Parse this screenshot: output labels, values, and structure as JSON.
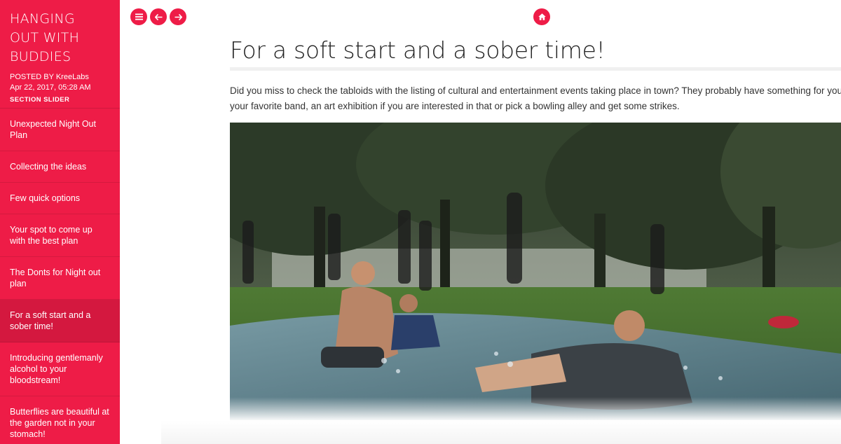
{
  "sidebar": {
    "title": "HANGING OUT WITH BUDDIES",
    "posted_by_label": "POSTED BY",
    "author": "KreeLabs",
    "date": "Apr 22, 2017, 05:28 AM",
    "section": "SECTION SLIDER",
    "items": [
      {
        "label": "Unexpected Night Out Plan"
      },
      {
        "label": "Collecting the ideas"
      },
      {
        "label": "Few quick options"
      },
      {
        "label": "Your spot to come up with the best plan"
      },
      {
        "label": "The Donts for Night out plan"
      },
      {
        "label": "For a soft start and a sober time!"
      },
      {
        "label": "Introducing gentlemanly alcohol to your bloodstream!"
      },
      {
        "label": "Butterflies are beautiful at the garden not in your stomach!"
      }
    ],
    "active_index": 5
  },
  "toolbar": {
    "menu_icon": "menu-icon",
    "prev_icon": "arrow-left-icon",
    "next_icon": "arrow-right-icon",
    "home_icon": "home-icon"
  },
  "article": {
    "title": "For a soft start and a sober time!",
    "intro_line1": "Did you miss to check the tabloids with the listing of cultural and entertainment events taking place in town? They probably have something for you too.",
    "intro_line2": "your favorite band, an art exhibition if you are interested in that or pick a bowling alley and get some strikes.",
    "image_alt": "Teens sliding on a wet plastic slide in a park"
  },
  "colors": {
    "accent": "#ee1c47",
    "active_item": "#d4183f",
    "title_text": "#222222"
  }
}
